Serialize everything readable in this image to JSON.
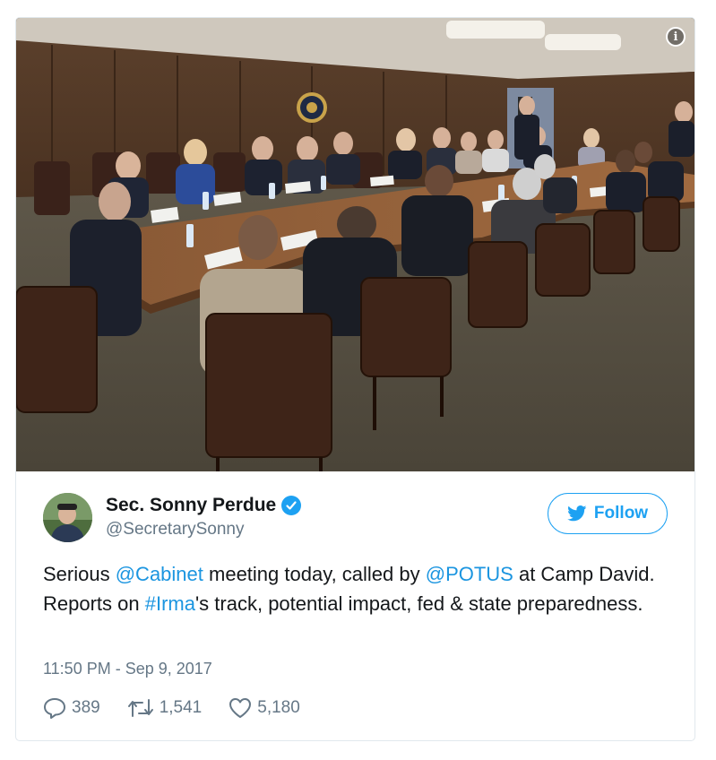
{
  "photo": {
    "alt": "Cabinet meeting photo",
    "info_icon": "info-icon",
    "info_glyph": "i"
  },
  "author": {
    "name": "Sec. Sonny Perdue",
    "handle": "@SecretarySonny",
    "verified": true,
    "avatar_icon": "avatar"
  },
  "follow_button": {
    "label": "Follow",
    "icon": "twitter-bird-icon"
  },
  "tweet": {
    "parts": [
      {
        "text": "Serious ",
        "link": false
      },
      {
        "text": "@Cabinet",
        "link": true
      },
      {
        "text": " meeting today, called by ",
        "link": false
      },
      {
        "text": "@POTUS",
        "link": true
      },
      {
        "text": " at Camp David. Reports on ",
        "link": false
      },
      {
        "text": "#Irma",
        "link": true
      },
      {
        "text": "'s track, potential impact, fed & state preparedness.",
        "link": false
      }
    ],
    "timestamp": "11:50 PM - Sep 9, 2017"
  },
  "actions": {
    "replies": "389",
    "retweets": "1,541",
    "likes": "5,180"
  },
  "colors": {
    "accent": "#1da1f2",
    "link": "#1b95e0",
    "muted": "#657786",
    "border": "#e1e8ed"
  }
}
